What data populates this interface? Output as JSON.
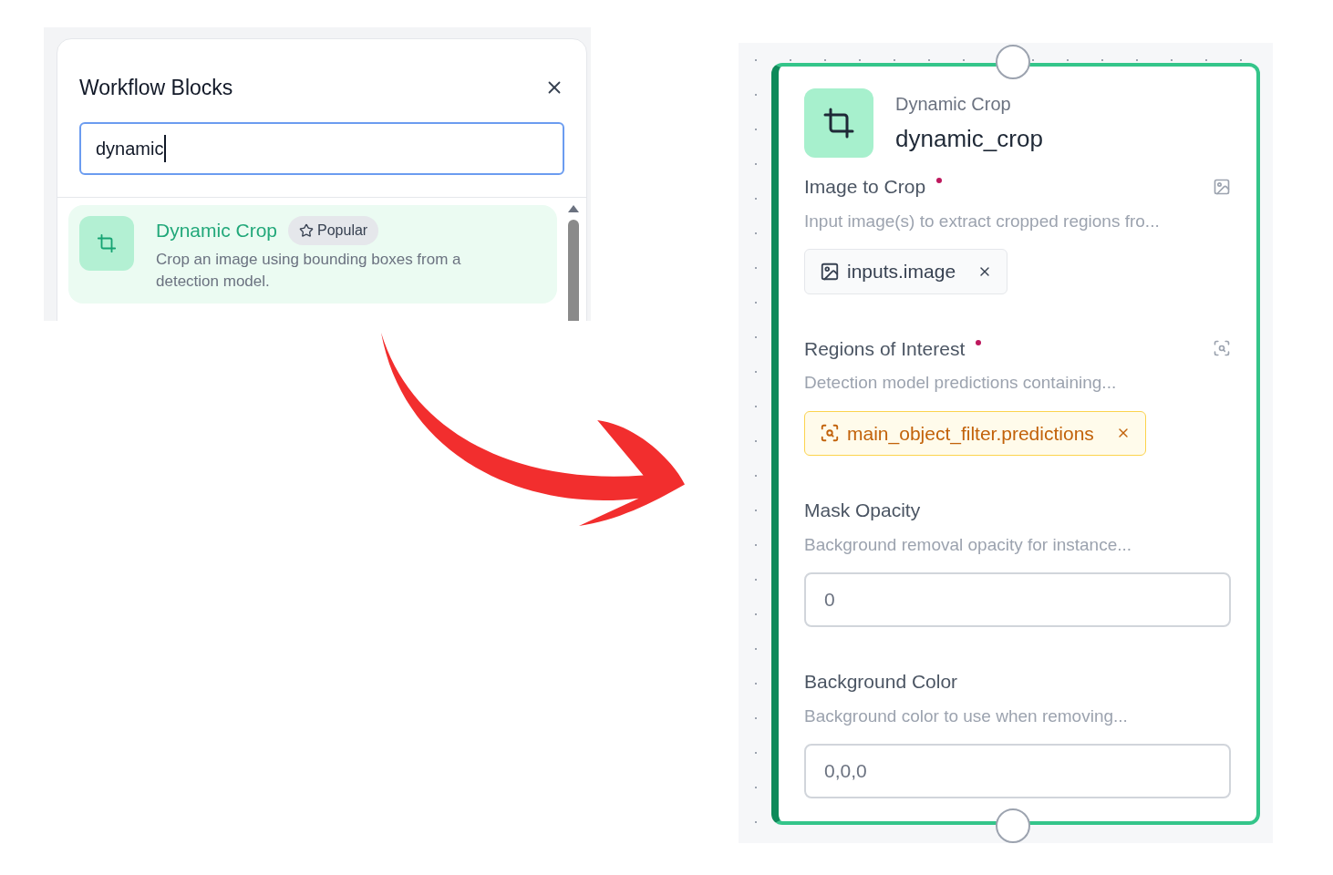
{
  "search_panel": {
    "title": "Workflow Blocks",
    "search": {
      "value": "dynamic"
    },
    "results": [
      {
        "title": "Dynamic Crop",
        "badge": "Popular",
        "description": "Crop an image using bounding boxes from a detection model.",
        "selected": true
      }
    ]
  },
  "node": {
    "type_label": "Dynamic Crop",
    "name": "dynamic_crop",
    "selected": true,
    "fields": [
      {
        "kind": "connection",
        "label": "Image to Crop",
        "required": true,
        "description": "Input image(s) to extract cropped regions fro...",
        "chip": {
          "kind": "image",
          "label": "inputs.image"
        }
      },
      {
        "kind": "connection",
        "label": "Regions of Interest",
        "required": true,
        "description": "Detection model predictions containing...",
        "chip": {
          "kind": "predictions",
          "label": "main_object_filter.predictions"
        }
      },
      {
        "kind": "input",
        "label": "Mask Opacity",
        "required": false,
        "description": "Background removal opacity for instance...",
        "value": "0"
      },
      {
        "kind": "input",
        "label": "Background Color",
        "required": false,
        "description": "Background color to use when removing...",
        "value": "0,0,0"
      }
    ]
  }
}
